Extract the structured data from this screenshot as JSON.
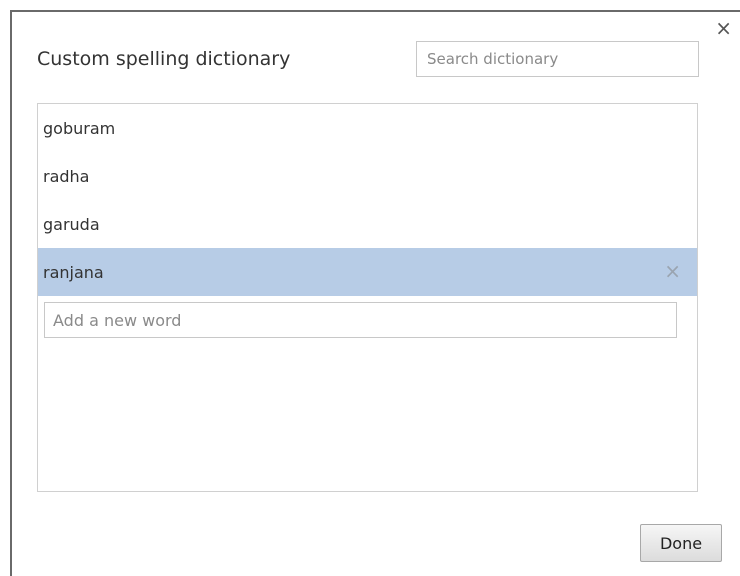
{
  "dialog": {
    "title": "Custom spelling dictionary",
    "close_symbol": "×",
    "search": {
      "placeholder": "Search dictionary",
      "value": ""
    }
  },
  "words": [
    {
      "text": "goburam",
      "selected": false
    },
    {
      "text": "radha",
      "selected": false
    },
    {
      "text": "garuda",
      "selected": false
    },
    {
      "text": "ranjana",
      "selected": true,
      "delete_symbol": "×"
    }
  ],
  "new_word": {
    "placeholder": "Add a new word",
    "value": ""
  },
  "footer": {
    "done_label": "Done"
  },
  "colors": {
    "selected_row": "#b7cce6",
    "border": "#d0d0d0",
    "text": "#333333"
  }
}
